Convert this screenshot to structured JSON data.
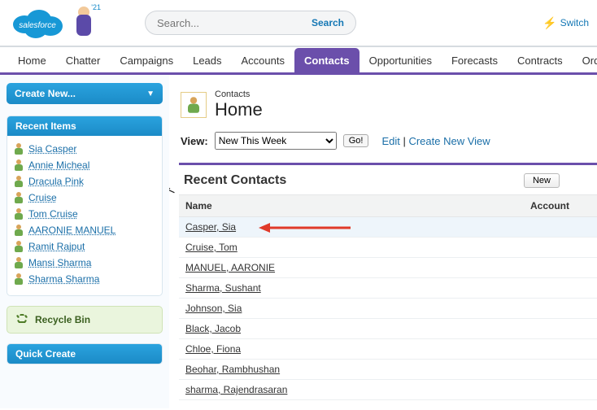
{
  "header": {
    "brand": "salesforce",
    "mascot_badge": "'21",
    "search_placeholder": "Search...",
    "search_button": "Search",
    "switch_label": "Switch"
  },
  "tabs": [
    {
      "label": "Home",
      "active": false
    },
    {
      "label": "Chatter",
      "active": false
    },
    {
      "label": "Campaigns",
      "active": false
    },
    {
      "label": "Leads",
      "active": false
    },
    {
      "label": "Accounts",
      "active": false
    },
    {
      "label": "Contacts",
      "active": true
    },
    {
      "label": "Opportunities",
      "active": false
    },
    {
      "label": "Forecasts",
      "active": false
    },
    {
      "label": "Contracts",
      "active": false
    },
    {
      "label": "Orde",
      "active": false
    }
  ],
  "sidebar": {
    "create_new_label": "Create New...",
    "recent_items_header": "Recent Items",
    "recent_items": [
      "Sia Casper",
      "Annie Micheal",
      "Dracula Pink",
      "Cruise",
      "Tom Cruise",
      "AARONIE MANUEL",
      "Ramit Rajput",
      "Mansi Sharma",
      "Sharma Sharma"
    ],
    "recycle_label": "Recycle Bin",
    "quick_create_header": "Quick Create"
  },
  "page": {
    "crumb": "Contacts",
    "title": "Home",
    "view_label": "View:",
    "view_selected": "New This Week",
    "go_label": "Go!",
    "edit_label": "Edit",
    "sep": " | ",
    "create_view_label": "Create New View"
  },
  "recent_contacts": {
    "heading": "Recent Contacts",
    "new_button": "New",
    "columns": {
      "name": "Name",
      "account": "Account"
    },
    "rows": [
      {
        "name": "Casper, Sia",
        "highlight": true
      },
      {
        "name": "Cruise, Tom"
      },
      {
        "name": "MANUEL, AARONIE"
      },
      {
        "name": "Sharma, Sushant"
      },
      {
        "name": "Johnson, Sia"
      },
      {
        "name": "Black, Jacob"
      },
      {
        "name": "Chloe, Fiona"
      },
      {
        "name": "Beohar, Rambhushan"
      },
      {
        "name": "sharma, Rajendrasaran"
      }
    ]
  }
}
